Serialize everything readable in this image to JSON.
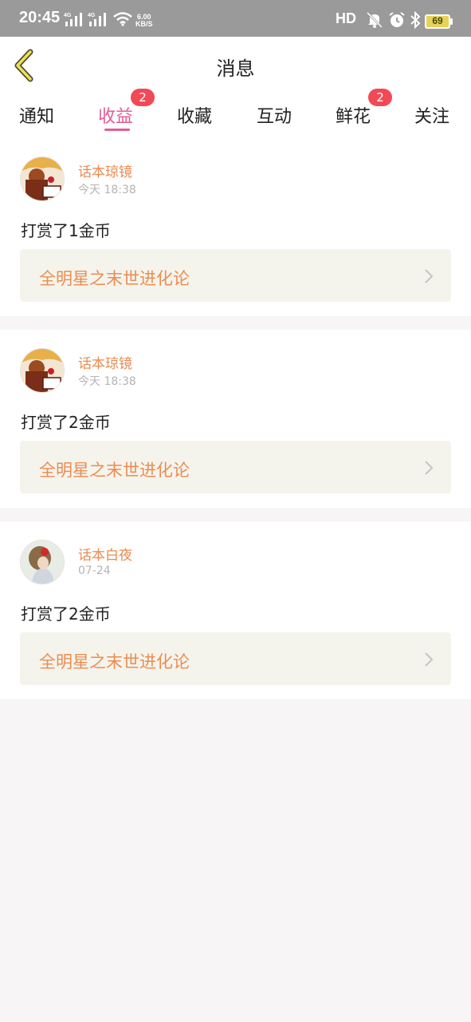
{
  "status_bar": {
    "time": "20:45",
    "network_1": "4G",
    "network_2": "4G",
    "speed_value": "6.00",
    "speed_unit": "KB/S",
    "hd": "HD",
    "battery": "69"
  },
  "header": {
    "title": "消息",
    "back_icon": "chevron-left-icon"
  },
  "tabs": [
    {
      "label": "通知",
      "active": false
    },
    {
      "label": "收益",
      "active": true,
      "badge": "2"
    },
    {
      "label": "收藏",
      "active": false
    },
    {
      "label": "互动",
      "active": false
    },
    {
      "label": "鲜花",
      "active": false,
      "badge": "2"
    },
    {
      "label": "关注",
      "active": false
    }
  ],
  "messages": [
    {
      "username": "话本琼镜",
      "time": "今天 18:38",
      "content": "打赏了1金币",
      "book": "全明星之末世进化论"
    },
    {
      "username": "话本琼镜",
      "time": "今天 18:38",
      "content": "打赏了2金币",
      "book": "全明星之末世进化论"
    },
    {
      "username": "话本白夜",
      "time": "07-24",
      "content": "打赏了2金币",
      "book": "全明星之末世进化论"
    }
  ],
  "colors": {
    "accent": "#e45c95",
    "badge": "#f24957",
    "username": "#ea8a4e",
    "book_bg": "#f5f4ec"
  }
}
